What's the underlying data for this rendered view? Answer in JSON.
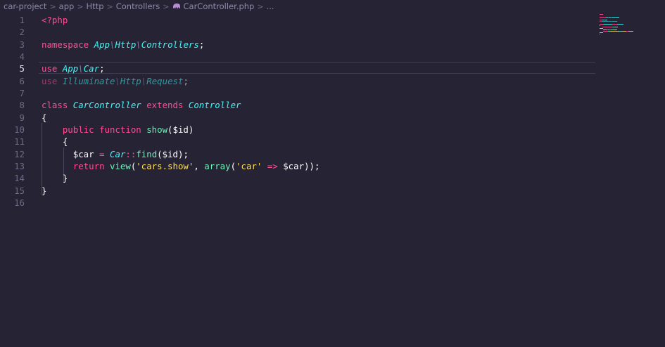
{
  "breadcrumb": {
    "items": [
      "car-project",
      "app",
      "Http",
      "Controllers",
      "CarController.php",
      "..."
    ],
    "separator": ">"
  },
  "editor": {
    "active_line": 5,
    "lines": [
      {
        "n": "1",
        "tokens": [
          {
            "t": "<?php",
            "c": "tag"
          }
        ]
      },
      {
        "n": "2",
        "tokens": []
      },
      {
        "n": "3",
        "tokens": [
          {
            "t": "namespace ",
            "c": "kw"
          },
          {
            "t": "App",
            "c": "ns"
          },
          {
            "t": "\\",
            "c": "nsep"
          },
          {
            "t": "Http",
            "c": "ns"
          },
          {
            "t": "\\",
            "c": "nsep"
          },
          {
            "t": "Controllers",
            "c": "ns"
          },
          {
            "t": ";",
            "c": "plain"
          }
        ]
      },
      {
        "n": "4",
        "tokens": []
      },
      {
        "n": "5",
        "tokens": [
          {
            "t": "use ",
            "c": "kw"
          },
          {
            "t": "App",
            "c": "ns"
          },
          {
            "t": "\\",
            "c": "nsep"
          },
          {
            "t": "Car",
            "c": "ns"
          },
          {
            "t": ";",
            "c": "plain"
          }
        ]
      },
      {
        "n": "6",
        "dim": true,
        "tokens": [
          {
            "t": "use ",
            "c": "kw"
          },
          {
            "t": "Illuminate",
            "c": "ns"
          },
          {
            "t": "\\",
            "c": "nsep"
          },
          {
            "t": "Http",
            "c": "ns"
          },
          {
            "t": "\\",
            "c": "nsep"
          },
          {
            "t": "Request",
            "c": "ns"
          },
          {
            "t": ";",
            "c": "plain"
          }
        ]
      },
      {
        "n": "7",
        "tokens": []
      },
      {
        "n": "8",
        "tokens": [
          {
            "t": "class ",
            "c": "kw"
          },
          {
            "t": "CarController ",
            "c": "cls"
          },
          {
            "t": "extends ",
            "c": "kw"
          },
          {
            "t": "Controller",
            "c": "cls"
          }
        ]
      },
      {
        "n": "9",
        "tokens": [
          {
            "t": "{",
            "c": "plain"
          }
        ]
      },
      {
        "n": "10",
        "tokens": [
          {
            "t": "    ",
            "c": "plain"
          },
          {
            "t": "public ",
            "c": "kw"
          },
          {
            "t": "function ",
            "c": "kw"
          },
          {
            "t": "show",
            "c": "fn"
          },
          {
            "t": "($id)",
            "c": "plain"
          }
        ]
      },
      {
        "n": "11",
        "tokens": [
          {
            "t": "    {",
            "c": "plain"
          }
        ]
      },
      {
        "n": "12",
        "tokens": [
          {
            "t": "      ",
            "c": "plain"
          },
          {
            "t": "$car ",
            "c": "var"
          },
          {
            "t": "= ",
            "c": "op"
          },
          {
            "t": "Car",
            "c": "cls"
          },
          {
            "t": "::",
            "c": "op"
          },
          {
            "t": "find",
            "c": "fn"
          },
          {
            "t": "($id);",
            "c": "plain"
          }
        ]
      },
      {
        "n": "13",
        "tokens": [
          {
            "t": "      ",
            "c": "plain"
          },
          {
            "t": "return ",
            "c": "kw"
          },
          {
            "t": "view",
            "c": "fn"
          },
          {
            "t": "(",
            "c": "plain"
          },
          {
            "t": "'cars.show'",
            "c": "str2"
          },
          {
            "t": ", ",
            "c": "plain"
          },
          {
            "t": "array",
            "c": "fn"
          },
          {
            "t": "(",
            "c": "plain"
          },
          {
            "t": "'car'",
            "c": "str2"
          },
          {
            "t": " => ",
            "c": "op"
          },
          {
            "t": "$car",
            "c": "var"
          },
          {
            "t": "));",
            "c": "plain"
          }
        ]
      },
      {
        "n": "14",
        "tokens": [
          {
            "t": "    }",
            "c": "plain"
          }
        ]
      },
      {
        "n": "15",
        "tokens": [
          {
            "t": "}",
            "c": "plain"
          }
        ]
      },
      {
        "n": "16",
        "tokens": []
      }
    ]
  },
  "colors": {
    "background": "#262335",
    "keyword": "#fe4f93",
    "class": "#36f9f6",
    "function": "#72f1b8",
    "string": "#fede5d",
    "line_number": "#6e6a86"
  }
}
